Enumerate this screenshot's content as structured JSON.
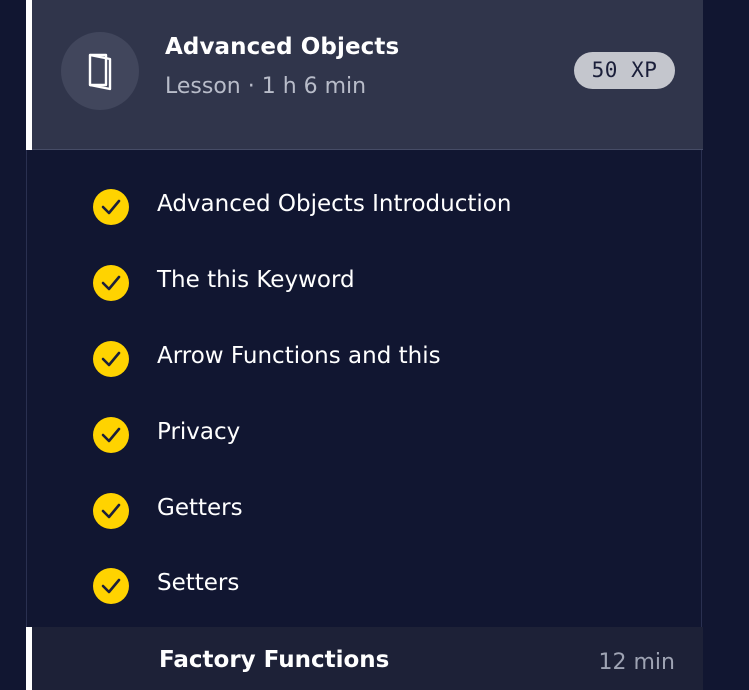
{
  "lesson": {
    "title": "Advanced Objects",
    "meta": "Lesson · 1 h 6 min",
    "xp": "50 XP",
    "icon": "book-icon"
  },
  "items": [
    {
      "label": "Advanced Objects Introduction",
      "completed": true
    },
    {
      "label": "The this Keyword",
      "completed": true
    },
    {
      "label": "Arrow Functions and this",
      "completed": true
    },
    {
      "label": "Privacy",
      "completed": true
    },
    {
      "label": "Getters",
      "completed": true
    },
    {
      "label": "Setters",
      "completed": true
    }
  ],
  "current": {
    "label": "Factory Functions",
    "duration": "12 min"
  },
  "colors": {
    "background": "#111631",
    "header": "#30354b",
    "check": "#ffd300",
    "badge": "#c4c6cd"
  }
}
